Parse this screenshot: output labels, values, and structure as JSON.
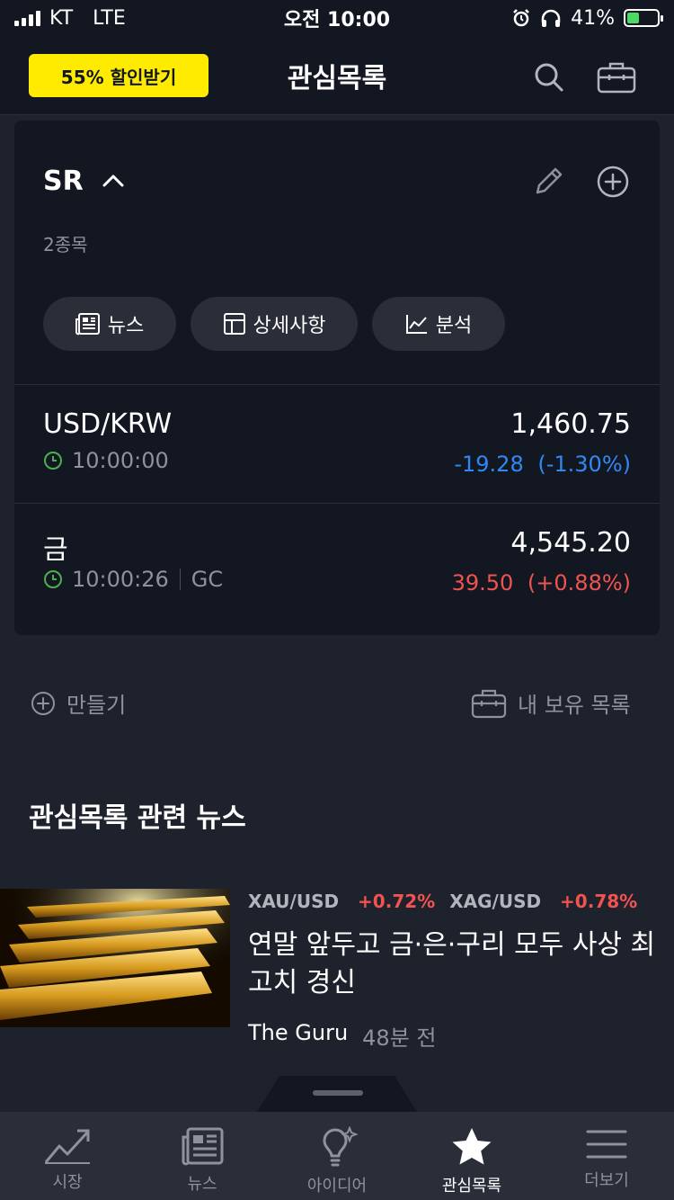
{
  "status_bar": {
    "carrier": "KT",
    "network": "LTE",
    "time": "오전 10:00",
    "battery": "41%",
    "battery_level": 0.41
  },
  "header": {
    "promo_label": "55% 할인받기",
    "title": "관심목록",
    "icons": [
      "search-icon",
      "briefcase-icon"
    ]
  },
  "watchlist": {
    "name": "SR",
    "count": "2종목",
    "chips": [
      {
        "label": "뉴스",
        "icon": "newspaper-icon"
      },
      {
        "label": "상세사항",
        "icon": "table-icon"
      },
      {
        "label": "분석",
        "icon": "chart-icon"
      }
    ],
    "items": [
      {
        "symbol": "USD/KRW",
        "time": "10:00:00",
        "exchange": "",
        "price": "1,460.75",
        "change": "-19.28",
        "change_pct": "(-1.30%)",
        "direction": "down"
      },
      {
        "symbol": "금",
        "time": "10:00:26",
        "exchange": "GC",
        "price": "4,545.20",
        "change": "39.50",
        "change_pct": "(+0.88%)",
        "direction": "up"
      }
    ]
  },
  "actions": {
    "create_label": "만들기",
    "portfolio_label": "내 보유 목록"
  },
  "news": {
    "heading": "관심목록 관련 뉴스",
    "article": {
      "tag1_name": "XAU/USD",
      "tag1_change": "+0.72%",
      "tag2_name": "XAG/USD",
      "tag2_change": "+0.78%",
      "title": "연말 앞두고 금·은·구리 모두 사상 최고치 경신",
      "source": "The Guru",
      "time": "48분 전"
    }
  },
  "tabbar": {
    "tabs": [
      {
        "label": "시장",
        "icon": "market-chart-icon",
        "active": false
      },
      {
        "label": "뉴스",
        "icon": "newspaper-icon",
        "active": false
      },
      {
        "label": "아이디어",
        "icon": "lightbulb-icon",
        "active": false
      },
      {
        "label": "관심목록",
        "icon": "star-icon",
        "active": true
      },
      {
        "label": "더보기",
        "icon": "menu-icon",
        "active": false
      }
    ]
  },
  "colors": {
    "background": "#1e222d",
    "surface": "#131722",
    "promo": "#ffeb00",
    "negative": "#2f89f5",
    "positive": "#f05350",
    "clock": "#4caf50"
  }
}
